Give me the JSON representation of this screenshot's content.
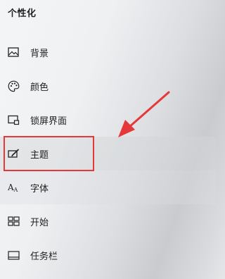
{
  "page_title": "个性化",
  "nav": {
    "items": [
      {
        "label": "背景",
        "icon": "image-icon"
      },
      {
        "label": "颜色",
        "icon": "palette-icon"
      },
      {
        "label": "锁屏界面",
        "icon": "lock-screen-icon"
      },
      {
        "label": "主题",
        "icon": "theme-brush-icon"
      },
      {
        "label": "字体",
        "icon": "font-icon"
      },
      {
        "label": "开始",
        "icon": "start-tiles-icon"
      },
      {
        "label": "任务栏",
        "icon": "taskbar-icon"
      }
    ],
    "annotated_item": "主题"
  },
  "colors": {
    "annotation": "#e6373a",
    "text": "#1f1f1f"
  }
}
